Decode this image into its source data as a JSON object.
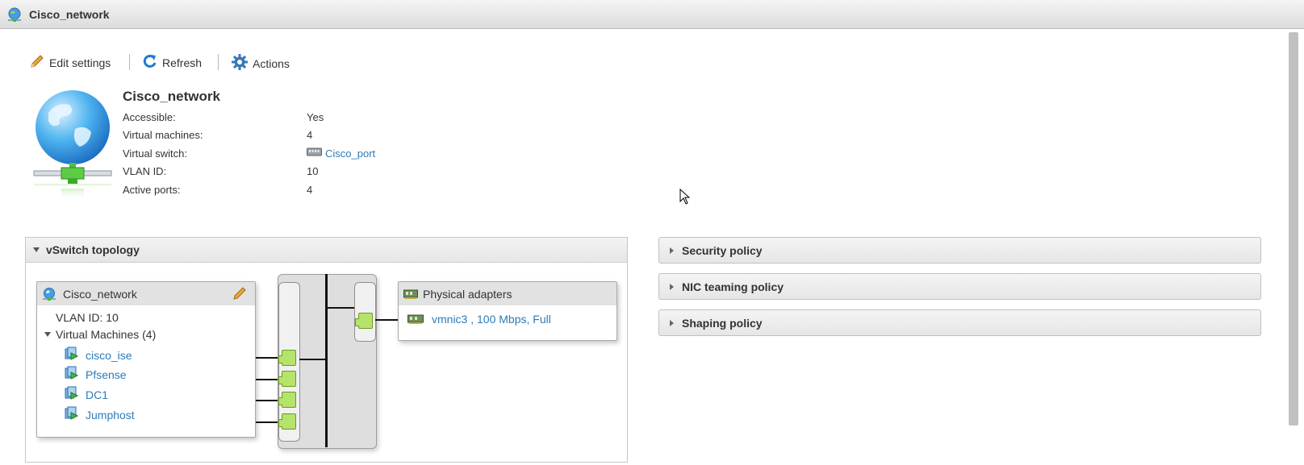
{
  "window": {
    "title": "Cisco_network"
  },
  "toolbar": {
    "edit_label": "Edit settings",
    "refresh_label": "Refresh",
    "actions_label": "Actions"
  },
  "summary": {
    "name": "Cisco_network",
    "rows": [
      {
        "label": "Accessible:",
        "value": "Yes"
      },
      {
        "label": "Virtual machines:",
        "value": "4"
      },
      {
        "label": "Virtual switch:",
        "value": "Cisco_port"
      },
      {
        "label": "VLAN ID:",
        "value": "10"
      },
      {
        "label": "Active ports:",
        "value": "4"
      }
    ]
  },
  "topology": {
    "header": "vSwitch topology",
    "portgroup": {
      "name": "Cisco_network",
      "vlan_text": "VLAN ID: 10",
      "vms_header": "Virtual Machines (4)",
      "vms": [
        "cisco_ise",
        "Pfsense",
        "DC1",
        "Jumphost"
      ]
    },
    "physical": {
      "header": "Physical adapters",
      "adapter": "vmnic3 , 100 Mbps, Full"
    }
  },
  "policies": [
    {
      "label": "Security policy"
    },
    {
      "label": "NIC teaming policy"
    },
    {
      "label": "Shaping policy"
    }
  ],
  "colors": {
    "link": "#2e7bb8",
    "port_green": "#b6e36a",
    "header_gray": "#e2e2e2"
  }
}
